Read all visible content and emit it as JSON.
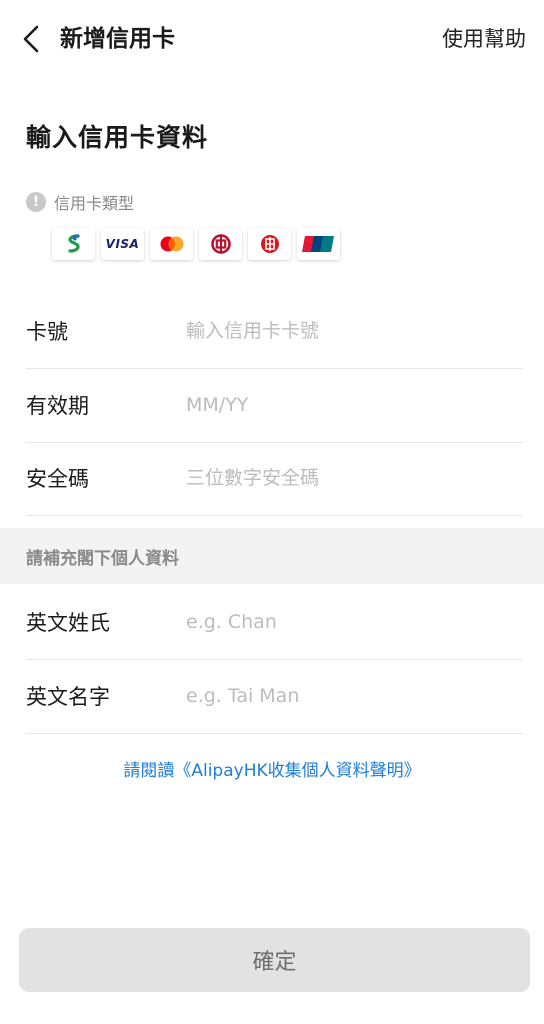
{
  "header": {
    "title": "新增信用卡",
    "help_label": "使用幫助"
  },
  "section": {
    "heading": "輸入信用卡資料",
    "card_type_label": "信用卡類型",
    "info_glyph": "!"
  },
  "card_logos": [
    {
      "name": "standard-chartered",
      "label": ""
    },
    {
      "name": "visa",
      "label": "VISA"
    },
    {
      "name": "mastercard",
      "label": ""
    },
    {
      "name": "bank-of-china",
      "label": ""
    },
    {
      "name": "icbc",
      "label": ""
    },
    {
      "name": "unionpay",
      "label": "UnionPay"
    }
  ],
  "card_form": {
    "card_number": {
      "label": "卡號",
      "placeholder": "輸入信用卡卡號",
      "value": ""
    },
    "expiry": {
      "label": "有效期",
      "placeholder": "MM/YY",
      "value": ""
    },
    "cvv": {
      "label": "安全碼",
      "placeholder": "三位數字安全碼",
      "value": ""
    }
  },
  "personal": {
    "band_label": "請補充閣下個人資料",
    "surname": {
      "label": "英文姓氏",
      "placeholder": "e.g. Chan",
      "value": ""
    },
    "given_name": {
      "label": "英文名字",
      "placeholder": "e.g. Tai Man",
      "value": ""
    }
  },
  "disclaimer_link": "請閱讀《AlipayHK收集個人資料聲明》",
  "confirm_label": "確定",
  "colors": {
    "link": "#1d7ed8",
    "button_bg": "#e2e2e2",
    "placeholder": "#bcbcbc"
  }
}
